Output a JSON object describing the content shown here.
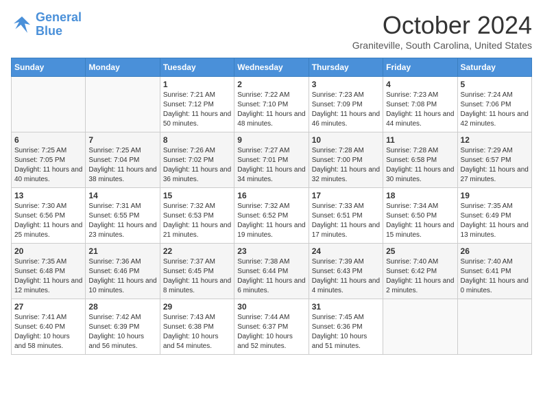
{
  "logo": {
    "line1": "General",
    "line2": "Blue"
  },
  "title": "October 2024",
  "location": "Graniteville, South Carolina, United States",
  "days_of_week": [
    "Sunday",
    "Monday",
    "Tuesday",
    "Wednesday",
    "Thursday",
    "Friday",
    "Saturday"
  ],
  "weeks": [
    [
      {
        "day": "",
        "content": ""
      },
      {
        "day": "",
        "content": ""
      },
      {
        "day": "1",
        "content": "Sunrise: 7:21 AM\nSunset: 7:12 PM\nDaylight: 11 hours and 50 minutes."
      },
      {
        "day": "2",
        "content": "Sunrise: 7:22 AM\nSunset: 7:10 PM\nDaylight: 11 hours and 48 minutes."
      },
      {
        "day": "3",
        "content": "Sunrise: 7:23 AM\nSunset: 7:09 PM\nDaylight: 11 hours and 46 minutes."
      },
      {
        "day": "4",
        "content": "Sunrise: 7:23 AM\nSunset: 7:08 PM\nDaylight: 11 hours and 44 minutes."
      },
      {
        "day": "5",
        "content": "Sunrise: 7:24 AM\nSunset: 7:06 PM\nDaylight: 11 hours and 42 minutes."
      }
    ],
    [
      {
        "day": "6",
        "content": "Sunrise: 7:25 AM\nSunset: 7:05 PM\nDaylight: 11 hours and 40 minutes."
      },
      {
        "day": "7",
        "content": "Sunrise: 7:25 AM\nSunset: 7:04 PM\nDaylight: 11 hours and 38 minutes."
      },
      {
        "day": "8",
        "content": "Sunrise: 7:26 AM\nSunset: 7:02 PM\nDaylight: 11 hours and 36 minutes."
      },
      {
        "day": "9",
        "content": "Sunrise: 7:27 AM\nSunset: 7:01 PM\nDaylight: 11 hours and 34 minutes."
      },
      {
        "day": "10",
        "content": "Sunrise: 7:28 AM\nSunset: 7:00 PM\nDaylight: 11 hours and 32 minutes."
      },
      {
        "day": "11",
        "content": "Sunrise: 7:28 AM\nSunset: 6:58 PM\nDaylight: 11 hours and 30 minutes."
      },
      {
        "day": "12",
        "content": "Sunrise: 7:29 AM\nSunset: 6:57 PM\nDaylight: 11 hours and 27 minutes."
      }
    ],
    [
      {
        "day": "13",
        "content": "Sunrise: 7:30 AM\nSunset: 6:56 PM\nDaylight: 11 hours and 25 minutes."
      },
      {
        "day": "14",
        "content": "Sunrise: 7:31 AM\nSunset: 6:55 PM\nDaylight: 11 hours and 23 minutes."
      },
      {
        "day": "15",
        "content": "Sunrise: 7:32 AM\nSunset: 6:53 PM\nDaylight: 11 hours and 21 minutes."
      },
      {
        "day": "16",
        "content": "Sunrise: 7:32 AM\nSunset: 6:52 PM\nDaylight: 11 hours and 19 minutes."
      },
      {
        "day": "17",
        "content": "Sunrise: 7:33 AM\nSunset: 6:51 PM\nDaylight: 11 hours and 17 minutes."
      },
      {
        "day": "18",
        "content": "Sunrise: 7:34 AM\nSunset: 6:50 PM\nDaylight: 11 hours and 15 minutes."
      },
      {
        "day": "19",
        "content": "Sunrise: 7:35 AM\nSunset: 6:49 PM\nDaylight: 11 hours and 13 minutes."
      }
    ],
    [
      {
        "day": "20",
        "content": "Sunrise: 7:35 AM\nSunset: 6:48 PM\nDaylight: 11 hours and 12 minutes."
      },
      {
        "day": "21",
        "content": "Sunrise: 7:36 AM\nSunset: 6:46 PM\nDaylight: 11 hours and 10 minutes."
      },
      {
        "day": "22",
        "content": "Sunrise: 7:37 AM\nSunset: 6:45 PM\nDaylight: 11 hours and 8 minutes."
      },
      {
        "day": "23",
        "content": "Sunrise: 7:38 AM\nSunset: 6:44 PM\nDaylight: 11 hours and 6 minutes."
      },
      {
        "day": "24",
        "content": "Sunrise: 7:39 AM\nSunset: 6:43 PM\nDaylight: 11 hours and 4 minutes."
      },
      {
        "day": "25",
        "content": "Sunrise: 7:40 AM\nSunset: 6:42 PM\nDaylight: 11 hours and 2 minutes."
      },
      {
        "day": "26",
        "content": "Sunrise: 7:40 AM\nSunset: 6:41 PM\nDaylight: 11 hours and 0 minutes."
      }
    ],
    [
      {
        "day": "27",
        "content": "Sunrise: 7:41 AM\nSunset: 6:40 PM\nDaylight: 10 hours and 58 minutes."
      },
      {
        "day": "28",
        "content": "Sunrise: 7:42 AM\nSunset: 6:39 PM\nDaylight: 10 hours and 56 minutes."
      },
      {
        "day": "29",
        "content": "Sunrise: 7:43 AM\nSunset: 6:38 PM\nDaylight: 10 hours and 54 minutes."
      },
      {
        "day": "30",
        "content": "Sunrise: 7:44 AM\nSunset: 6:37 PM\nDaylight: 10 hours and 52 minutes."
      },
      {
        "day": "31",
        "content": "Sunrise: 7:45 AM\nSunset: 6:36 PM\nDaylight: 10 hours and 51 minutes."
      },
      {
        "day": "",
        "content": ""
      },
      {
        "day": "",
        "content": ""
      }
    ]
  ]
}
